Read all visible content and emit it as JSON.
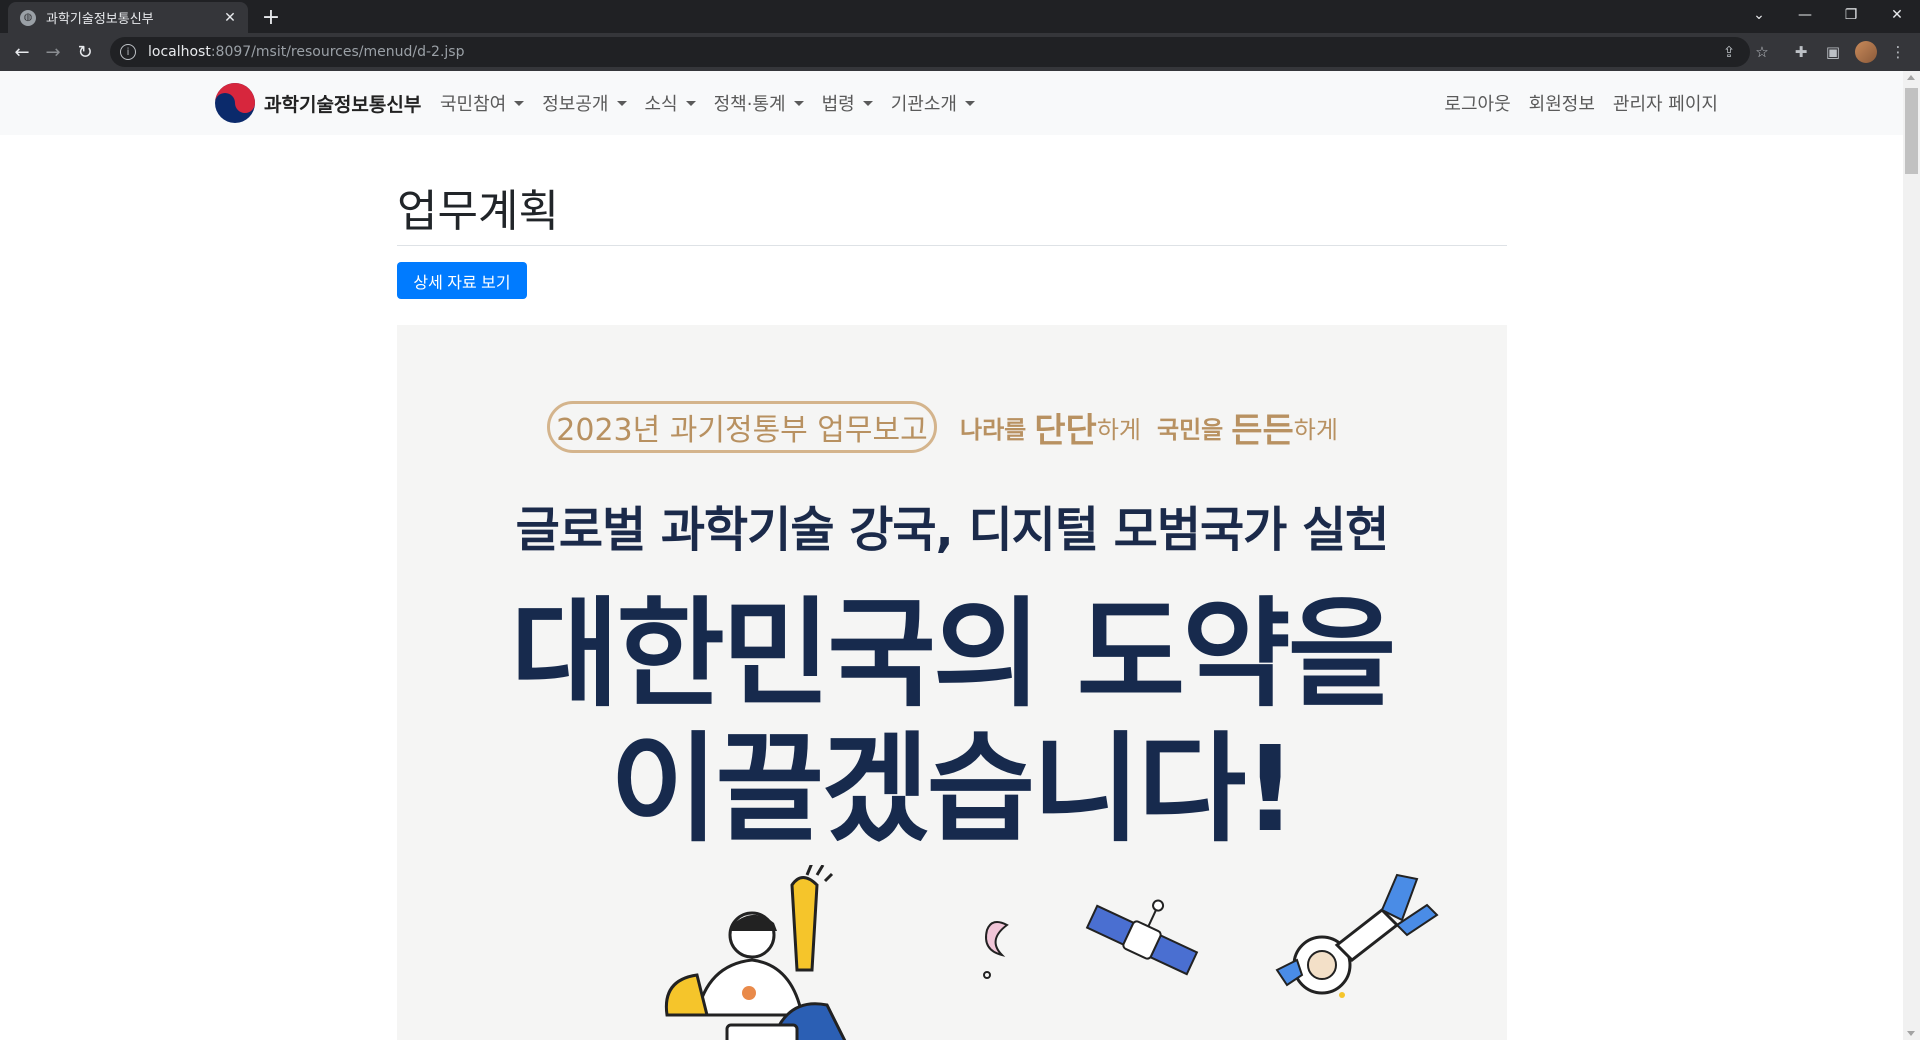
{
  "browser": {
    "tab_title": "과학기술정보통신부",
    "url_host": "localhost",
    "url_path": ":8097/msit/resources/menud/d-2.jsp"
  },
  "site": {
    "brand": "과학기술정보통신부",
    "menu": [
      "국민참여",
      "정보공개",
      "소식",
      "정책·통계",
      "법령",
      "기관소개"
    ],
    "right_links": [
      "로그아웃",
      "회원정보",
      "관리자 페이지"
    ]
  },
  "page": {
    "title": "업무계획",
    "detail_button": "상세 자료 보기"
  },
  "poster": {
    "pill": "2023년 과기정통부 업무보고",
    "slogan_1a": "나라를",
    "slogan_1b": "단단",
    "slogan_1c": "하게",
    "slogan_2a": "국민을",
    "slogan_2b": "든든",
    "slogan_2c": "하게",
    "headline": "글로벌 과학기술 강국, 디지털 모범국가 실현",
    "mega_line1": "대한민국의 도약을",
    "mega_line2": "이끌겠습니다!"
  },
  "colors": {
    "primary": "#007bff",
    "poster_gold": "#b89161",
    "poster_navy": "#172a4d"
  }
}
